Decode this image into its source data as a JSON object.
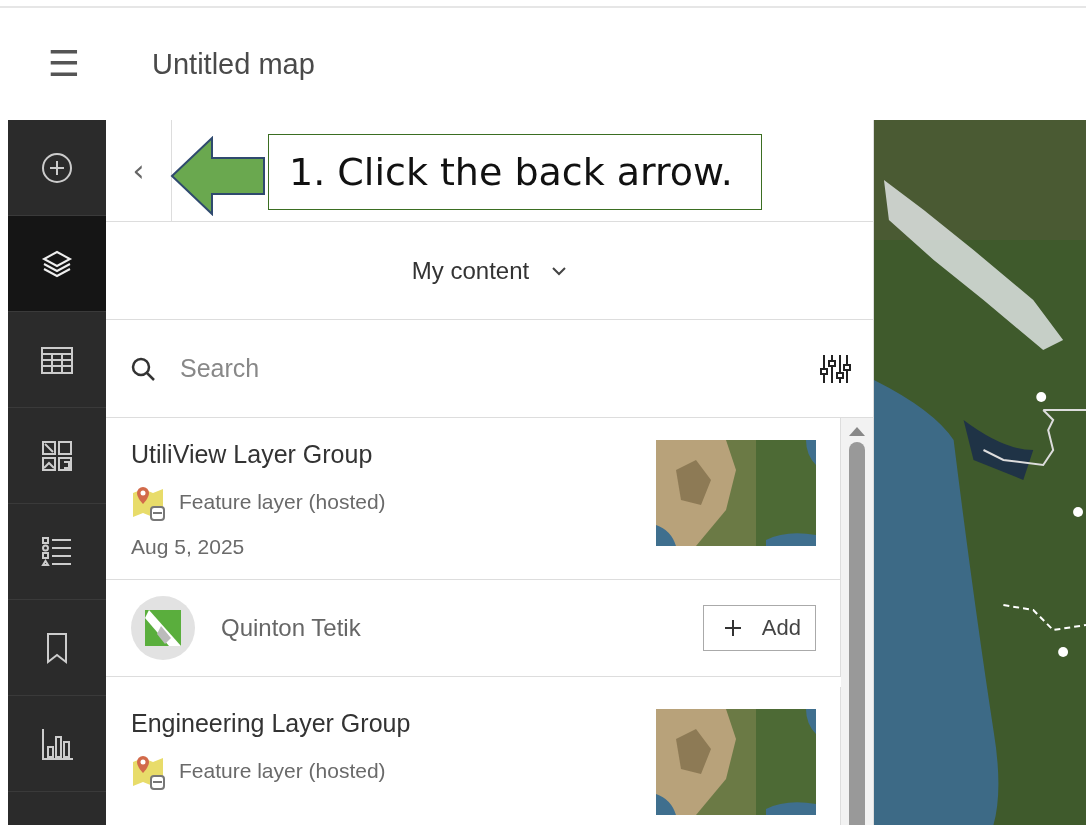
{
  "header": {
    "menu_icon": "☰",
    "title": "Untitled map"
  },
  "rail": {
    "items": [
      {
        "kind": "add",
        "selected": false
      },
      {
        "kind": "layers",
        "selected": true
      },
      {
        "kind": "table",
        "selected": false
      },
      {
        "kind": "gallery",
        "selected": false
      },
      {
        "kind": "legend",
        "selected": false
      },
      {
        "kind": "bookmark",
        "selected": false
      },
      {
        "kind": "chart",
        "selected": false
      }
    ]
  },
  "panel": {
    "back": "‹",
    "source": "My content",
    "search": {
      "placeholder": "Search"
    },
    "items": [
      {
        "title": "UtiliView Layer Group",
        "type": "Feature layer (hosted)",
        "date": "Aug 5, 2025",
        "owner": "Quinton Tetik",
        "action": "Add"
      },
      {
        "title": "Engineering Layer Group",
        "type": "Feature layer (hosted)"
      }
    ]
  },
  "callout": {
    "text": "1. Click the back arrow."
  }
}
